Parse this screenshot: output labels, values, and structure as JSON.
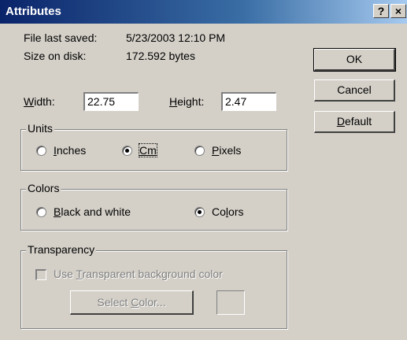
{
  "window": {
    "title": "Attributes",
    "help_glyph": "?",
    "close_glyph": "×"
  },
  "info": {
    "last_saved_label": "File last saved:",
    "last_saved_value": "5/23/2003 12:10 PM",
    "size_label": "Size on disk:",
    "size_value": "172.592 bytes"
  },
  "dimensions": {
    "width_label_u": "W",
    "width_label_rest": "idth:",
    "width_value": "22.75",
    "height_label_u": "H",
    "height_label_rest": "eight:",
    "height_value": "2.47"
  },
  "units": {
    "group_label": "Units",
    "inches_u": "I",
    "inches_rest": "nches",
    "cm_u": "Cm",
    "cm_rest": "",
    "pixels_u": "P",
    "pixels_rest": "ixels",
    "selected": "Cm"
  },
  "colors": {
    "group_label": "Colors",
    "bw_u": "B",
    "bw_rest": "lack and white",
    "colors_pre": "Co",
    "colors_u": "l",
    "colors_rest": "ors",
    "selected": "Colors"
  },
  "transparency": {
    "group_label": "Transparency",
    "check_pre": "Use ",
    "check_u": "T",
    "check_rest": "ransparent background color",
    "select_pre": "Select ",
    "select_u": "C",
    "select_rest": "olor...",
    "checked": false,
    "enabled": false
  },
  "buttons": {
    "ok": "OK",
    "cancel": "Cancel",
    "default_u": "D",
    "default_rest": "efault"
  },
  "colors_theme": {
    "titlebar_start": "#0a246a",
    "titlebar_end": "#a6caf0",
    "face": "#d4d0c8"
  }
}
